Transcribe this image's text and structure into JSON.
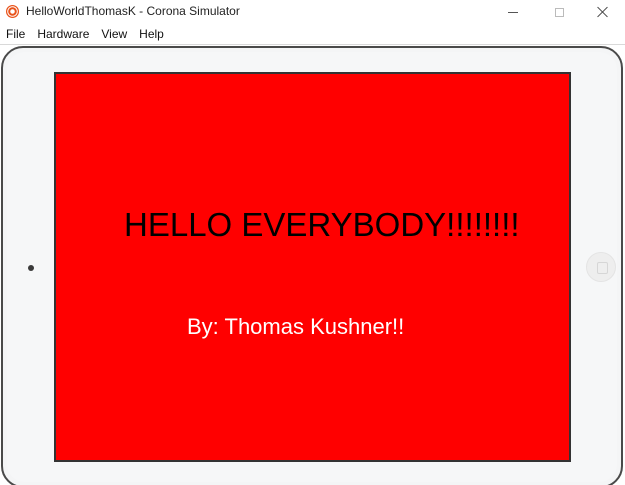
{
  "window": {
    "title": "HelloWorldThomasK - Corona Simulator",
    "icon": "corona-app-icon",
    "controls": [
      "minimize-icon",
      "maximize-icon",
      "close-icon"
    ]
  },
  "menu": {
    "items": [
      {
        "label": "File"
      },
      {
        "label": "Hardware"
      },
      {
        "label": "View"
      },
      {
        "label": "Help"
      }
    ]
  },
  "device": {
    "type": "tablet",
    "frame_color": "#f4f5f6"
  },
  "screen": {
    "background": "#ff0000",
    "headline": "HELLO EVERYBODY!!!!!!!!",
    "byline": "By: Thomas Kushner!!"
  }
}
